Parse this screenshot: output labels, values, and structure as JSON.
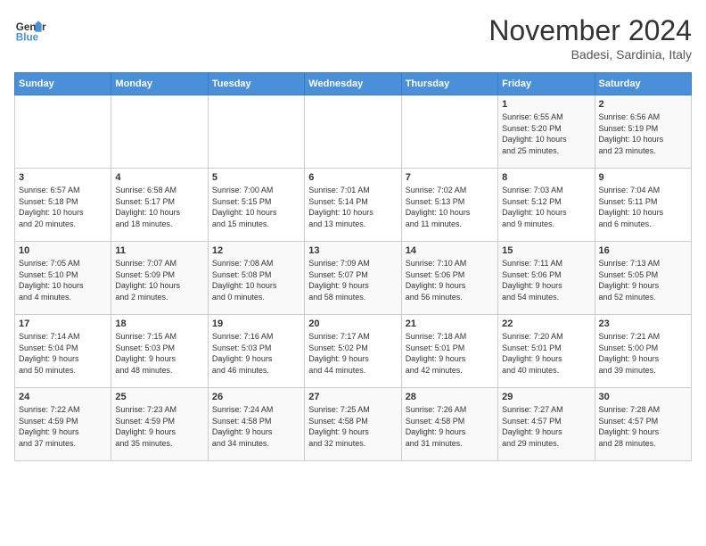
{
  "header": {
    "logo_line1": "General",
    "logo_line2": "Blue",
    "month_title": "November 2024",
    "location": "Badesi, Sardinia, Italy"
  },
  "days_of_week": [
    "Sunday",
    "Monday",
    "Tuesday",
    "Wednesday",
    "Thursday",
    "Friday",
    "Saturday"
  ],
  "weeks": [
    [
      {
        "num": "",
        "info": ""
      },
      {
        "num": "",
        "info": ""
      },
      {
        "num": "",
        "info": ""
      },
      {
        "num": "",
        "info": ""
      },
      {
        "num": "",
        "info": ""
      },
      {
        "num": "1",
        "info": "Sunrise: 6:55 AM\nSunset: 5:20 PM\nDaylight: 10 hours\nand 25 minutes."
      },
      {
        "num": "2",
        "info": "Sunrise: 6:56 AM\nSunset: 5:19 PM\nDaylight: 10 hours\nand 23 minutes."
      }
    ],
    [
      {
        "num": "3",
        "info": "Sunrise: 6:57 AM\nSunset: 5:18 PM\nDaylight: 10 hours\nand 20 minutes."
      },
      {
        "num": "4",
        "info": "Sunrise: 6:58 AM\nSunset: 5:17 PM\nDaylight: 10 hours\nand 18 minutes."
      },
      {
        "num": "5",
        "info": "Sunrise: 7:00 AM\nSunset: 5:15 PM\nDaylight: 10 hours\nand 15 minutes."
      },
      {
        "num": "6",
        "info": "Sunrise: 7:01 AM\nSunset: 5:14 PM\nDaylight: 10 hours\nand 13 minutes."
      },
      {
        "num": "7",
        "info": "Sunrise: 7:02 AM\nSunset: 5:13 PM\nDaylight: 10 hours\nand 11 minutes."
      },
      {
        "num": "8",
        "info": "Sunrise: 7:03 AM\nSunset: 5:12 PM\nDaylight: 10 hours\nand 9 minutes."
      },
      {
        "num": "9",
        "info": "Sunrise: 7:04 AM\nSunset: 5:11 PM\nDaylight: 10 hours\nand 6 minutes."
      }
    ],
    [
      {
        "num": "10",
        "info": "Sunrise: 7:05 AM\nSunset: 5:10 PM\nDaylight: 10 hours\nand 4 minutes."
      },
      {
        "num": "11",
        "info": "Sunrise: 7:07 AM\nSunset: 5:09 PM\nDaylight: 10 hours\nand 2 minutes."
      },
      {
        "num": "12",
        "info": "Sunrise: 7:08 AM\nSunset: 5:08 PM\nDaylight: 10 hours\nand 0 minutes."
      },
      {
        "num": "13",
        "info": "Sunrise: 7:09 AM\nSunset: 5:07 PM\nDaylight: 9 hours\nand 58 minutes."
      },
      {
        "num": "14",
        "info": "Sunrise: 7:10 AM\nSunset: 5:06 PM\nDaylight: 9 hours\nand 56 minutes."
      },
      {
        "num": "15",
        "info": "Sunrise: 7:11 AM\nSunset: 5:06 PM\nDaylight: 9 hours\nand 54 minutes."
      },
      {
        "num": "16",
        "info": "Sunrise: 7:13 AM\nSunset: 5:05 PM\nDaylight: 9 hours\nand 52 minutes."
      }
    ],
    [
      {
        "num": "17",
        "info": "Sunrise: 7:14 AM\nSunset: 5:04 PM\nDaylight: 9 hours\nand 50 minutes."
      },
      {
        "num": "18",
        "info": "Sunrise: 7:15 AM\nSunset: 5:03 PM\nDaylight: 9 hours\nand 48 minutes."
      },
      {
        "num": "19",
        "info": "Sunrise: 7:16 AM\nSunset: 5:03 PM\nDaylight: 9 hours\nand 46 minutes."
      },
      {
        "num": "20",
        "info": "Sunrise: 7:17 AM\nSunset: 5:02 PM\nDaylight: 9 hours\nand 44 minutes."
      },
      {
        "num": "21",
        "info": "Sunrise: 7:18 AM\nSunset: 5:01 PM\nDaylight: 9 hours\nand 42 minutes."
      },
      {
        "num": "22",
        "info": "Sunrise: 7:20 AM\nSunset: 5:01 PM\nDaylight: 9 hours\nand 40 minutes."
      },
      {
        "num": "23",
        "info": "Sunrise: 7:21 AM\nSunset: 5:00 PM\nDaylight: 9 hours\nand 39 minutes."
      }
    ],
    [
      {
        "num": "24",
        "info": "Sunrise: 7:22 AM\nSunset: 4:59 PM\nDaylight: 9 hours\nand 37 minutes."
      },
      {
        "num": "25",
        "info": "Sunrise: 7:23 AM\nSunset: 4:59 PM\nDaylight: 9 hours\nand 35 minutes."
      },
      {
        "num": "26",
        "info": "Sunrise: 7:24 AM\nSunset: 4:58 PM\nDaylight: 9 hours\nand 34 minutes."
      },
      {
        "num": "27",
        "info": "Sunrise: 7:25 AM\nSunset: 4:58 PM\nDaylight: 9 hours\nand 32 minutes."
      },
      {
        "num": "28",
        "info": "Sunrise: 7:26 AM\nSunset: 4:58 PM\nDaylight: 9 hours\nand 31 minutes."
      },
      {
        "num": "29",
        "info": "Sunrise: 7:27 AM\nSunset: 4:57 PM\nDaylight: 9 hours\nand 29 minutes."
      },
      {
        "num": "30",
        "info": "Sunrise: 7:28 AM\nSunset: 4:57 PM\nDaylight: 9 hours\nand 28 minutes."
      }
    ]
  ]
}
